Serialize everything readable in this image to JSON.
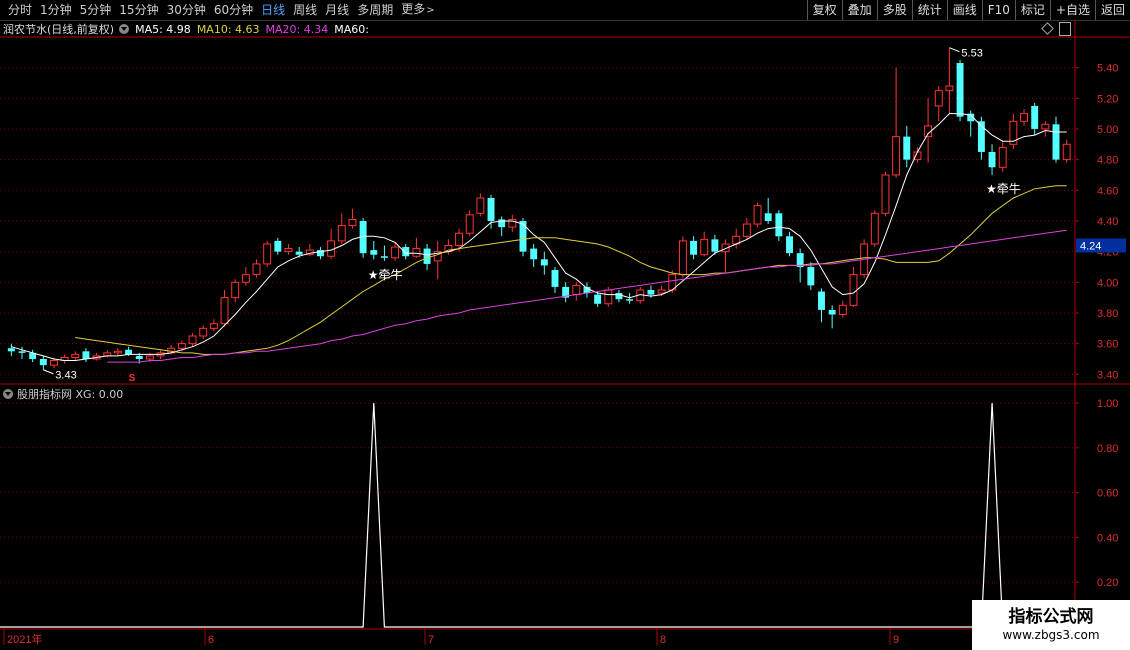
{
  "toolbar": {
    "periods": [
      "分时",
      "1分钟",
      "5分钟",
      "15分钟",
      "30分钟",
      "60分钟",
      "日线",
      "周线",
      "月线",
      "多周期",
      "更多"
    ],
    "active_period": "日线",
    "buttons": [
      "复权",
      "叠加",
      "多股",
      "统计",
      "画线",
      "F10",
      "标记",
      "+自选",
      "返回"
    ]
  },
  "main_chart": {
    "title": "润农节水(日线,前复权)",
    "ma5_label": "MA5: 4.98",
    "ma10_label": "MA10: 4.63",
    "ma20_label": "MA20: 4.34",
    "ma60_label": "MA60:",
    "ma5_color": "#ffffff",
    "ma10_color": "#e0d040",
    "ma20_color": "#e040e0",
    "ma60_color": "#ffffff",
    "up_color": "#ff3333",
    "down_color": "#54ffff",
    "price_ticks": [
      "5.40",
      "5.20",
      "5.00",
      "4.80",
      "4.60",
      "4.40",
      "4.20",
      "4.00",
      "3.80",
      "3.60",
      "3.40"
    ],
    "current_price": "4.24",
    "high_label": "5.53",
    "low_label": "3.43",
    "signal_label": "★牵牛",
    "marker_s": "S"
  },
  "sub_chart": {
    "title": "股朋指标网 XG: 0.00",
    "ticks": [
      "1.00",
      "0.80",
      "0.60",
      "0.40",
      "0.20"
    ]
  },
  "time_axis": [
    "2021年",
    "6",
    "7",
    "8",
    "9"
  ],
  "watermark": {
    "title": "指标公式网",
    "url": "www.zbgs3.com"
  },
  "chart_data": {
    "type": "candlestick",
    "ylim": [
      3.35,
      5.58
    ],
    "candles": [
      [
        3.57,
        3.55,
        3.6,
        3.52
      ],
      [
        3.55,
        3.54,
        3.58,
        3.5
      ],
      [
        3.54,
        3.5,
        3.56,
        3.48
      ],
      [
        3.5,
        3.46,
        3.52,
        3.43
      ],
      [
        3.46,
        3.49,
        3.51,
        3.44
      ],
      [
        3.49,
        3.51,
        3.53,
        3.47
      ],
      [
        3.51,
        3.53,
        3.55,
        3.49
      ],
      [
        3.55,
        3.5,
        3.57,
        3.48
      ],
      [
        3.5,
        3.52,
        3.54,
        3.49
      ],
      [
        3.52,
        3.54,
        3.56,
        3.51
      ],
      [
        3.54,
        3.55,
        3.57,
        3.52
      ],
      [
        3.56,
        3.53,
        3.58,
        3.52
      ],
      [
        3.52,
        3.5,
        3.54,
        3.47
      ],
      [
        3.5,
        3.52,
        3.54,
        3.48
      ],
      [
        3.52,
        3.54,
        3.56,
        3.5
      ],
      [
        3.54,
        3.57,
        3.59,
        3.53
      ],
      [
        3.57,
        3.6,
        3.62,
        3.55
      ],
      [
        3.6,
        3.65,
        3.67,
        3.58
      ],
      [
        3.65,
        3.7,
        3.72,
        3.63
      ],
      [
        3.7,
        3.73,
        3.76,
        3.68
      ],
      [
        3.73,
        3.9,
        3.95,
        3.71
      ],
      [
        3.9,
        4.0,
        4.02,
        3.87
      ],
      [
        4.0,
        4.05,
        4.1,
        3.98
      ],
      [
        4.05,
        4.12,
        4.15,
        4.03
      ],
      [
        4.12,
        4.25,
        4.27,
        4.1
      ],
      [
        4.27,
        4.2,
        4.29,
        4.18
      ],
      [
        4.2,
        4.22,
        4.25,
        4.18
      ],
      [
        4.2,
        4.18,
        4.23,
        4.16
      ],
      [
        4.18,
        4.21,
        4.25,
        4.17
      ],
      [
        4.21,
        4.17,
        4.23,
        4.15
      ],
      [
        4.17,
        4.27,
        4.35,
        4.15
      ],
      [
        4.27,
        4.37,
        4.45,
        4.25
      ],
      [
        4.37,
        4.41,
        4.48,
        4.35
      ],
      [
        4.4,
        4.19,
        4.42,
        4.16
      ],
      [
        4.21,
        4.18,
        4.27,
        4.15
      ],
      [
        4.17,
        4.16,
        4.24,
        4.14
      ],
      [
        4.16,
        4.23,
        4.26,
        4.14
      ],
      [
        4.23,
        4.17,
        4.25,
        4.15
      ],
      [
        4.17,
        4.22,
        4.29,
        4.16
      ],
      [
        4.22,
        4.12,
        4.25,
        4.08
      ],
      [
        4.14,
        4.2,
        4.27,
        4.02
      ],
      [
        4.2,
        4.24,
        4.28,
        4.18
      ],
      [
        4.24,
        4.32,
        4.35,
        4.2
      ],
      [
        4.32,
        4.44,
        4.47,
        4.3
      ],
      [
        4.45,
        4.55,
        4.58,
        4.43
      ],
      [
        4.55,
        4.4,
        4.57,
        4.35
      ],
      [
        4.41,
        4.36,
        4.43,
        4.3
      ],
      [
        4.36,
        4.41,
        4.44,
        4.33
      ],
      [
        4.4,
        4.2,
        4.42,
        4.17
      ],
      [
        4.22,
        4.15,
        4.25,
        4.1
      ],
      [
        4.15,
        4.11,
        4.2,
        4.05
      ],
      [
        4.08,
        3.97,
        4.1,
        3.93
      ],
      [
        3.97,
        3.9,
        4.0,
        3.87
      ],
      [
        3.92,
        3.98,
        4.0,
        3.88
      ],
      [
        3.97,
        3.93,
        4.0,
        3.9
      ],
      [
        3.92,
        3.86,
        3.94,
        3.84
      ],
      [
        3.86,
        3.95,
        3.97,
        3.84
      ],
      [
        3.93,
        3.89,
        3.95,
        3.87
      ],
      [
        3.89,
        3.88,
        3.93,
        3.86
      ],
      [
        3.88,
        3.95,
        3.97,
        3.86
      ],
      [
        3.95,
        3.92,
        3.98,
        3.9
      ],
      [
        3.93,
        3.95,
        3.98,
        3.91
      ],
      [
        3.95,
        4.05,
        4.08,
        3.93
      ],
      [
        4.05,
        4.27,
        4.3,
        4.03
      ],
      [
        4.27,
        4.18,
        4.3,
        4.15
      ],
      [
        4.18,
        4.28,
        4.33,
        4.17
      ],
      [
        4.28,
        4.2,
        4.31,
        4.18
      ],
      [
        4.2,
        4.25,
        4.28,
        4.06
      ],
      [
        4.25,
        4.3,
        4.35,
        4.22
      ],
      [
        4.3,
        4.38,
        4.42,
        4.28
      ],
      [
        4.38,
        4.5,
        4.52,
        4.36
      ],
      [
        4.45,
        4.4,
        4.55,
        4.38
      ],
      [
        4.45,
        4.3,
        4.47,
        4.27
      ],
      [
        4.3,
        4.19,
        4.33,
        4.17
      ],
      [
        4.19,
        4.1,
        4.22,
        4.0
      ],
      [
        4.1,
        3.98,
        4.13,
        3.95
      ],
      [
        3.94,
        3.82,
        3.96,
        3.74
      ],
      [
        3.82,
        3.79,
        3.85,
        3.7
      ],
      [
        3.79,
        3.85,
        3.88,
        3.77
      ],
      [
        3.85,
        4.05,
        4.1,
        3.84
      ],
      [
        4.05,
        4.25,
        4.28,
        4.03
      ],
      [
        4.25,
        4.45,
        4.47,
        4.23
      ],
      [
        4.45,
        4.7,
        4.72,
        4.43
      ],
      [
        4.7,
        4.95,
        5.4,
        4.68
      ],
      [
        4.95,
        4.8,
        5.02,
        4.75
      ],
      [
        4.8,
        4.85,
        4.88,
        4.78
      ],
      [
        4.95,
        5.02,
        5.2,
        4.78
      ],
      [
        5.15,
        5.25,
        5.28,
        5.05
      ],
      [
        5.25,
        5.28,
        5.53,
        5.1
      ],
      [
        5.43,
        5.08,
        5.45,
        5.05
      ],
      [
        5.1,
        5.05,
        5.12,
        4.95
      ],
      [
        5.05,
        4.85,
        5.08,
        4.8
      ],
      [
        4.85,
        4.75,
        4.9,
        4.7
      ],
      [
        4.75,
        4.88,
        4.92,
        4.72
      ],
      [
        4.9,
        5.05,
        5.1,
        4.87
      ],
      [
        5.05,
        5.1,
        5.13,
        5.02
      ],
      [
        5.15,
        5.0,
        5.17,
        4.96
      ],
      [
        5.0,
        5.03,
        5.05,
        4.95
      ],
      [
        5.03,
        4.8,
        5.08,
        4.78
      ],
      [
        4.8,
        4.9,
        4.93,
        4.78
      ]
    ],
    "ma_lines": [
      {
        "name": "MA5",
        "values": [
          3.58,
          3.56,
          3.54,
          3.52,
          3.5,
          3.49,
          3.49,
          3.5,
          3.51,
          3.52,
          3.52,
          3.53,
          3.53,
          3.53,
          3.53,
          3.54,
          3.56,
          3.58,
          3.61,
          3.65,
          3.72,
          3.79,
          3.87,
          3.94,
          4.02,
          4.1,
          4.14,
          4.17,
          4.19,
          4.2,
          4.21,
          4.24,
          4.28,
          4.3,
          4.3,
          4.29,
          4.26,
          4.19,
          4.19,
          4.18,
          4.19,
          4.2,
          4.22,
          4.27,
          4.33,
          4.39,
          4.4,
          4.4,
          4.38,
          4.31,
          4.26,
          4.16,
          4.06,
          4.02,
          3.96,
          3.93,
          3.92,
          3.92,
          3.9,
          3.92,
          3.91,
          3.92,
          3.95,
          4.01,
          4.07,
          4.13,
          4.19,
          4.22,
          4.25,
          4.28,
          4.32,
          4.35,
          4.36,
          4.35,
          4.3,
          4.21,
          4.09,
          3.97,
          3.92,
          3.93,
          3.99,
          4.13,
          4.31,
          4.5,
          4.7,
          4.85,
          4.97,
          5.03,
          5.1,
          5.1,
          5.09,
          5.02,
          4.96,
          4.92,
          4.92,
          4.95,
          4.96,
          4.99,
          4.98,
          4.98
        ]
      },
      {
        "name": "MA10",
        "values": [
          3.64,
          3.63,
          3.62,
          3.61,
          3.6,
          3.59,
          3.58,
          3.57,
          3.56,
          3.55,
          3.54,
          3.54,
          3.53,
          3.53,
          3.53,
          3.54,
          3.55,
          3.56,
          3.57,
          3.59,
          3.62,
          3.66,
          3.7,
          3.74,
          3.79,
          3.84,
          3.89,
          3.94,
          3.98,
          4.02,
          4.05,
          4.09,
          4.13,
          4.16,
          4.18,
          4.21,
          4.22,
          4.23,
          4.24,
          4.25,
          4.26,
          4.27,
          4.28,
          4.29,
          4.29,
          4.29,
          4.28,
          4.27,
          4.26,
          4.25,
          4.23,
          4.2,
          4.17,
          4.13,
          4.1,
          4.08,
          4.06,
          4.05,
          4.05,
          4.05,
          4.06,
          4.06,
          4.07,
          4.08,
          4.09,
          4.1,
          4.11,
          4.11,
          4.11,
          4.12,
          4.12,
          4.13,
          4.14,
          4.15,
          4.16,
          4.16,
          4.15,
          4.13,
          4.13,
          4.13,
          4.13,
          4.14,
          4.19,
          4.25,
          4.31,
          4.38,
          4.45,
          4.5,
          4.55,
          4.58,
          4.61,
          4.62,
          4.63,
          4.63
        ]
      },
      {
        "name": "MA20",
        "values": [
          3.48,
          3.48,
          3.48,
          3.48,
          3.49,
          3.49,
          3.5,
          3.51,
          3.51,
          3.52,
          3.53,
          3.53,
          3.54,
          3.54,
          3.55,
          3.55,
          3.56,
          3.57,
          3.58,
          3.59,
          3.6,
          3.62,
          3.63,
          3.65,
          3.66,
          3.68,
          3.7,
          3.72,
          3.73,
          3.75,
          3.76,
          3.78,
          3.79,
          3.8,
          3.82,
          3.83,
          3.84,
          3.85,
          3.86,
          3.87,
          3.88,
          3.89,
          3.9,
          3.91,
          3.92,
          3.93,
          3.94,
          3.95,
          3.96,
          3.97,
          3.98,
          3.99,
          4.0,
          4.01,
          4.02,
          4.03,
          4.04,
          4.05,
          4.06,
          4.07,
          4.08,
          4.09,
          4.1,
          4.1,
          4.11,
          4.11,
          4.11,
          4.12,
          4.12,
          4.13,
          4.14,
          4.15,
          4.16,
          4.17,
          4.18,
          4.19,
          4.2,
          4.21,
          4.22,
          4.23,
          4.24,
          4.25,
          4.26,
          4.27,
          4.28,
          4.29,
          4.3,
          4.31,
          4.32,
          4.33,
          4.34
        ]
      }
    ],
    "xg_signal_indices": [
      34,
      92
    ]
  }
}
